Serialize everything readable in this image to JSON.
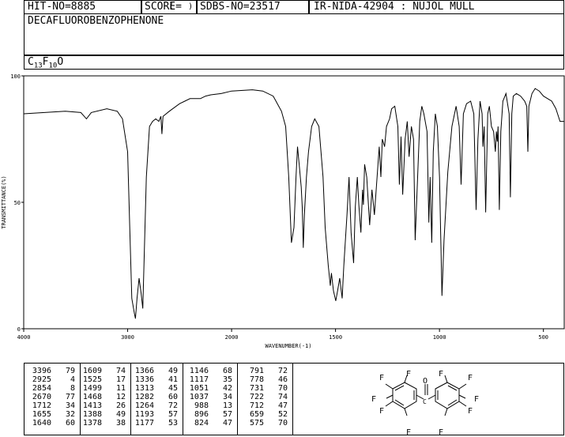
{
  "header": {
    "hit_no": "HIT-NO=8885",
    "score_label": "SCORE=",
    "score_value": "(   )",
    "sdbs_no": "SDBS-NO=23517",
    "ir_info": "IR-NIDA-42904 : NUJOL MULL"
  },
  "compound_name": "DECAFLUOROBENZOPHENONE",
  "formula": {
    "c": "C",
    "c_count": "13",
    "f": "F",
    "f_count": "10",
    "o": "O"
  },
  "chart_data": {
    "type": "line",
    "title": "",
    "xlabel": "WAVENUMBER(-1)",
    "ylabel": "TRANSMITTANCE(%)",
    "xlim": [
      4000,
      400
    ],
    "ylim": [
      0,
      100
    ],
    "x_ticks": [
      "4000",
      "3000",
      "2000",
      "1500",
      "1000",
      "500"
    ],
    "y_ticks": [
      "100",
      "50",
      "0"
    ],
    "series": [
      {
        "points": [
          [
            4000,
            85
          ],
          [
            3800,
            85.5
          ],
          [
            3600,
            86
          ],
          [
            3450,
            85.5
          ],
          [
            3396,
            83
          ],
          [
            3350,
            85.5
          ],
          [
            3200,
            87
          ],
          [
            3100,
            86
          ],
          [
            3050,
            83
          ],
          [
            3000,
            70
          ],
          [
            2980,
            40
          ],
          [
            2960,
            12
          ],
          [
            2935,
            6
          ],
          [
            2925,
            4
          ],
          [
            2910,
            12
          ],
          [
            2890,
            20
          ],
          [
            2870,
            14
          ],
          [
            2854,
            8
          ],
          [
            2840,
            30
          ],
          [
            2820,
            60
          ],
          [
            2790,
            80
          ],
          [
            2760,
            82
          ],
          [
            2730,
            83
          ],
          [
            2700,
            82
          ],
          [
            2680,
            84
          ],
          [
            2670,
            77
          ],
          [
            2660,
            84
          ],
          [
            2600,
            86
          ],
          [
            2500,
            89
          ],
          [
            2450,
            90
          ],
          [
            2400,
            91
          ],
          [
            2350,
            91
          ],
          [
            2300,
            91
          ],
          [
            2250,
            92
          ],
          [
            2200,
            92.5
          ],
          [
            2100,
            93
          ],
          [
            2000,
            94
          ],
          [
            1900,
            94.5
          ],
          [
            1850,
            94
          ],
          [
            1800,
            92
          ],
          [
            1780,
            89
          ],
          [
            1760,
            86
          ],
          [
            1740,
            80
          ],
          [
            1725,
            60
          ],
          [
            1712,
            34
          ],
          [
            1700,
            40
          ],
          [
            1690,
            60
          ],
          [
            1683,
            72
          ],
          [
            1675,
            65
          ],
          [
            1665,
            56
          ],
          [
            1660,
            48
          ],
          [
            1655,
            32
          ],
          [
            1650,
            45
          ],
          [
            1640,
            60
          ],
          [
            1630,
            70
          ],
          [
            1615,
            80
          ],
          [
            1600,
            83
          ],
          [
            1580,
            80
          ],
          [
            1570,
            70
          ],
          [
            1560,
            60
          ],
          [
            1550,
            40
          ],
          [
            1535,
            25
          ],
          [
            1525,
            17
          ],
          [
            1520,
            22
          ],
          [
            1510,
            15
          ],
          [
            1499,
            11
          ],
          [
            1490,
            15
          ],
          [
            1480,
            20
          ],
          [
            1468,
            12
          ],
          [
            1460,
            25
          ],
          [
            1445,
            45
          ],
          [
            1435,
            60
          ],
          [
            1425,
            38
          ],
          [
            1413,
            26
          ],
          [
            1405,
            48
          ],
          [
            1395,
            60
          ],
          [
            1388,
            49
          ],
          [
            1378,
            38
          ],
          [
            1370,
            55
          ],
          [
            1366,
            49
          ],
          [
            1360,
            65
          ],
          [
            1350,
            60
          ],
          [
            1336,
            41
          ],
          [
            1325,
            55
          ],
          [
            1313,
            45
          ],
          [
            1300,
            60
          ],
          [
            1290,
            72
          ],
          [
            1282,
            60
          ],
          [
            1275,
            75
          ],
          [
            1264,
            72
          ],
          [
            1255,
            80
          ],
          [
            1240,
            83
          ],
          [
            1230,
            87
          ],
          [
            1215,
            88
          ],
          [
            1200,
            80
          ],
          [
            1193,
            57
          ],
          [
            1185,
            76
          ],
          [
            1177,
            53
          ],
          [
            1165,
            75
          ],
          [
            1155,
            82
          ],
          [
            1146,
            68
          ],
          [
            1135,
            80
          ],
          [
            1125,
            75
          ],
          [
            1117,
            35
          ],
          [
            1105,
            60
          ],
          [
            1095,
            82
          ],
          [
            1085,
            88
          ],
          [
            1075,
            85
          ],
          [
            1060,
            78
          ],
          [
            1051,
            42
          ],
          [
            1045,
            60
          ],
          [
            1037,
            34
          ],
          [
            1030,
            70
          ],
          [
            1020,
            85
          ],
          [
            1010,
            80
          ],
          [
            1000,
            60
          ],
          [
            995,
            40
          ],
          [
            988,
            13
          ],
          [
            978,
            35
          ],
          [
            960,
            62
          ],
          [
            940,
            80
          ],
          [
            920,
            88
          ],
          [
            905,
            80
          ],
          [
            896,
            57
          ],
          [
            885,
            85
          ],
          [
            870,
            89
          ],
          [
            850,
            90
          ],
          [
            835,
            85
          ],
          [
            824,
            47
          ],
          [
            815,
            75
          ],
          [
            805,
            90
          ],
          [
            795,
            85
          ],
          [
            791,
            72
          ],
          [
            785,
            80
          ],
          [
            778,
            46
          ],
          [
            768,
            85
          ],
          [
            760,
            88
          ],
          [
            750,
            80
          ],
          [
            740,
            78
          ],
          [
            731,
            70
          ],
          [
            726,
            78
          ],
          [
            722,
            74
          ],
          [
            718,
            80
          ],
          [
            712,
            47
          ],
          [
            705,
            78
          ],
          [
            695,
            90
          ],
          [
            680,
            93
          ],
          [
            665,
            85
          ],
          [
            659,
            52
          ],
          [
            652,
            85
          ],
          [
            645,
            92
          ],
          [
            630,
            93
          ],
          [
            610,
            92
          ],
          [
            590,
            90
          ],
          [
            580,
            88
          ],
          [
            575,
            70
          ],
          [
            570,
            88
          ],
          [
            555,
            93
          ],
          [
            540,
            95
          ],
          [
            520,
            94
          ],
          [
            500,
            92
          ],
          [
            480,
            91
          ],
          [
            460,
            90
          ],
          [
            440,
            87
          ],
          [
            420,
            82
          ],
          [
            400,
            82
          ]
        ]
      }
    ]
  },
  "peak_table": [
    [
      [
        "3396",
        "79"
      ],
      [
        "2925",
        "4"
      ],
      [
        "2854",
        "8"
      ],
      [
        "2670",
        "77"
      ],
      [
        "1712",
        "34"
      ],
      [
        "1655",
        "32"
      ],
      [
        "1640",
        "60"
      ]
    ],
    [
      [
        "1609",
        "74"
      ],
      [
        "1525",
        "17"
      ],
      [
        "1499",
        "11"
      ],
      [
        "1468",
        "12"
      ],
      [
        "1413",
        "26"
      ],
      [
        "1388",
        "49"
      ],
      [
        "1378",
        "38"
      ]
    ],
    [
      [
        "1366",
        "49"
      ],
      [
        "1336",
        "41"
      ],
      [
        "1313",
        "45"
      ],
      [
        "1282",
        "60"
      ],
      [
        "1264",
        "72"
      ],
      [
        "1193",
        "57"
      ],
      [
        "1177",
        "53"
      ]
    ],
    [
      [
        "1146",
        "68"
      ],
      [
        "1117",
        "35"
      ],
      [
        "1051",
        "42"
      ],
      [
        "1037",
        "34"
      ],
      [
        "988",
        "13"
      ],
      [
        "896",
        "57"
      ],
      [
        "824",
        "47"
      ]
    ],
    [
      [
        "791",
        "72"
      ],
      [
        "778",
        "46"
      ],
      [
        "731",
        "70"
      ],
      [
        "722",
        "74"
      ],
      [
        "712",
        "47"
      ],
      [
        "659",
        "52"
      ],
      [
        "575",
        "70"
      ]
    ]
  ],
  "structure": {
    "f": "F",
    "o": "O"
  }
}
